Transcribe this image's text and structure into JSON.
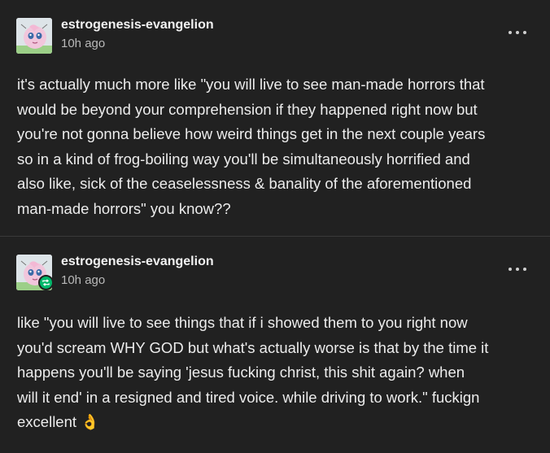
{
  "posts": [
    {
      "author": "estrogenesis-evangelion",
      "time": "10h ago",
      "is_reblog": false,
      "text": "it's actually much more like \"you will live to see man-made horrors that\nwould be beyond your comprehension if they happened right now but\nyou're not gonna believe how weird things get in the next couple years\nso in a kind of frog-boiling way you'll be simultaneously horrified and\nalso like, sick of the ceaselessness & banality of the aforementioned\nman-made horrors\" you know??"
    },
    {
      "author": "estrogenesis-evangelion",
      "time": "10h ago",
      "is_reblog": true,
      "text": "like \"you will live to see things that if i showed them to you right now\nyou'd scream WHY GOD but what's actually worse is that by the time it\nhappens you'll be saying 'jesus fucking christ, this shit again? when\nwill it end' in a resigned and tired voice. while driving to work.\" fuckign\nexcellent 👌"
    }
  ],
  "icons": {
    "more": "more-options-icon",
    "avatar": "jigglypuff-avatar",
    "reblog": "reblog-icon"
  },
  "colors": {
    "background": "#212121",
    "text": "#ececec",
    "muted": "#b9b9b9",
    "reblog_badge": "#00b86b"
  }
}
